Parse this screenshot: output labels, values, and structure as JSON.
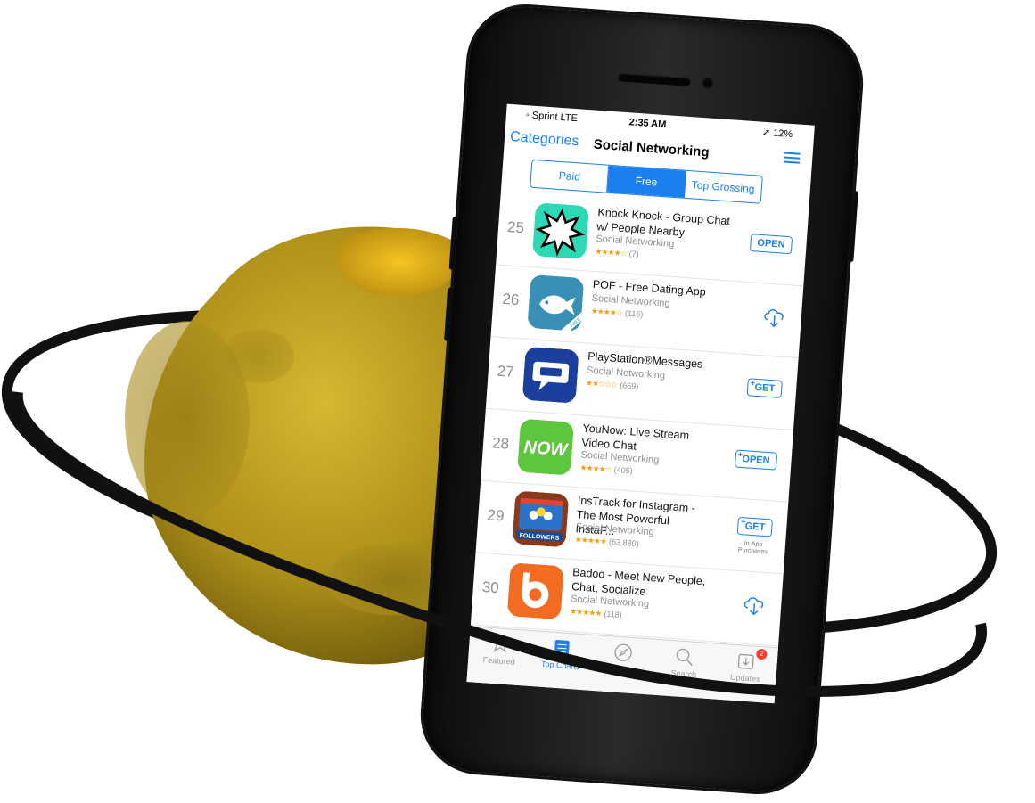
{
  "status": {
    "carrier": "◦ Sprint  LTE",
    "time": "2:35 AM",
    "battery": "➚ 12%"
  },
  "nav": {
    "back": "Categories",
    "title": "Social Networking"
  },
  "segments": [
    "Paid",
    "Free",
    "Top Grossing"
  ],
  "apps": [
    {
      "rank": "25",
      "name": "Knock Knock - Group Chat w/ People Nearby",
      "category": "Social Networking",
      "stars": "★★★★☆",
      "count": "(7)",
      "action": "OPEN",
      "iap": ""
    },
    {
      "rank": "26",
      "name": "POF - Free Dating App",
      "category": "Social Networking",
      "stars": "★★★★☆",
      "count": "(116)",
      "action": "",
      "iap": ""
    },
    {
      "rank": "27",
      "name": "PlayStation®Messages",
      "category": "Social Networking",
      "stars": "★★☆☆☆",
      "count": "(659)",
      "action": "GET",
      "iap": ""
    },
    {
      "rank": "28",
      "name": "YouNow: Live Stream Video Chat",
      "category": "Social Networking",
      "stars": "★★★★☆",
      "count": "(405)",
      "action": "OPEN",
      "iap": ""
    },
    {
      "rank": "29",
      "name": "InsTrack for Instagram - The Most Powerful InstaF...",
      "category": "Social Networking",
      "stars": "★★★★★",
      "count": "(63,880)",
      "action": "GET",
      "iap": "In-App Purchases"
    },
    {
      "rank": "30",
      "name": "Badoo - Meet New People, Chat, Socialize",
      "category": "Social Networking",
      "stars": "★★★★★",
      "count": "(118)",
      "action": "",
      "iap": ""
    }
  ],
  "icons": {
    "now_label": "NOW",
    "followers_label": "FOLLOWERS",
    "pof_label": "FREE"
  },
  "tabs": [
    {
      "label": "Featured"
    },
    {
      "label": "Top Charts"
    },
    {
      "label": "Explore"
    },
    {
      "label": "Search"
    },
    {
      "label": "Updates",
      "badge": "2"
    }
  ],
  "colors": {
    "accent": "#1a80f0",
    "planet": "#b89a1c",
    "knock": "#2fd8b5",
    "pof": "#3a8fb5",
    "playstation": "#1a3f9c",
    "younow": "#5cc63c",
    "badoo": "#f36b21"
  }
}
